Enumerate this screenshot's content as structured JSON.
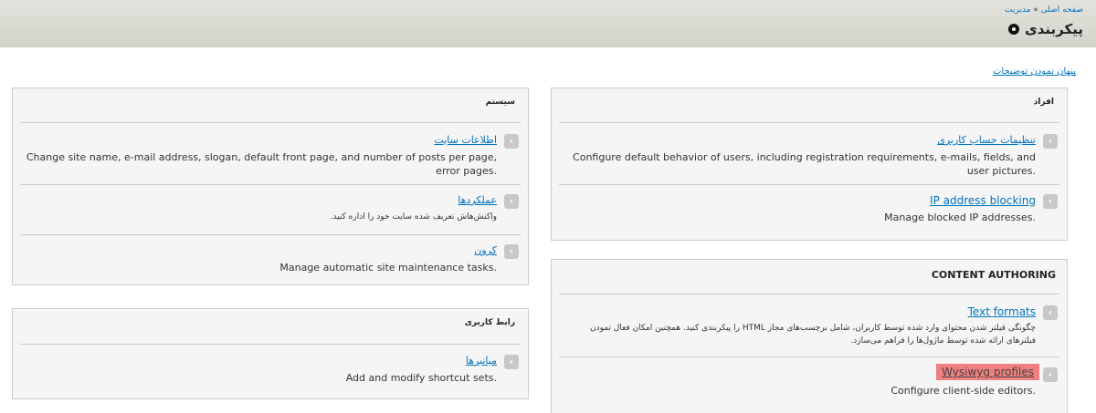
{
  "header": {
    "breadcrumb_home": "صفحه اصلی",
    "breadcrumb_sep": "»",
    "breadcrumb_admin": "مدیریت",
    "title": "پیکربندی"
  },
  "hide_descriptions": "پنهان نمودن توضیحات",
  "panels": {
    "people": {
      "title": "افراد",
      "items": [
        {
          "label": "تنظیمات حساب کاربری",
          "desc": "Configure default behavior of users, including registration requirements, e-mails, fields, and user pictures."
        },
        {
          "label": "IP address blocking",
          "desc": "Manage blocked IP addresses."
        }
      ]
    },
    "system": {
      "title": "سیستم",
      "items": [
        {
          "label": "اطلاعات سایت",
          "desc": "Change site name, e-mail address, slogan, default front page, and number of posts per page, error pages."
        },
        {
          "label": "عملکردها",
          "desc": "واکنش‌هاش تعریف شده سایت خود را اداره کنید."
        },
        {
          "label": "کرون",
          "desc": "Manage automatic site maintenance tasks."
        }
      ]
    },
    "content_authoring": {
      "title": "CONTENT AUTHORING",
      "items": [
        {
          "label": "Text formats",
          "desc": "چگونگی فیلتر شدن محتوای وارد شده توسط کاربران، شامل برچسب‌های مجاز HTML را پیکربندی کنید. همچنین امکان فعال نمودن فیلترهای ارائه شده توسط ماژول‌ها را فراهم می‌سازد."
        },
        {
          "label": "Wysiwyg profiles",
          "desc": "Configure client-side editors."
        }
      ]
    },
    "user_interface": {
      "title": "رابط کاربری",
      "items": [
        {
          "label": "میانبرها",
          "desc": "Add and modify shortcut sets."
        }
      ]
    }
  },
  "colors": {
    "link": "#0074bd",
    "highlight": "#f08080",
    "header_bg": "#dcdcd5"
  },
  "icons": {
    "item_arrow": "chevron-left-icon",
    "title_icon": "circle-plus-icon"
  }
}
